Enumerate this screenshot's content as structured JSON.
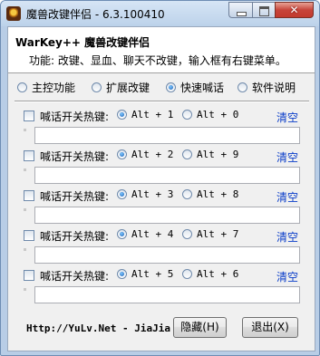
{
  "window": {
    "title": "魔兽改键伴侣 - 6.3.100410"
  },
  "header": {
    "title": "WarKey++ 魔兽改键伴侣",
    "subtitle": "功能: 改键、显血、聊天不改键，输入框有右键菜单。"
  },
  "tabs": [
    {
      "label": "主控功能",
      "selected": false
    },
    {
      "label": "扩展改键",
      "selected": false
    },
    {
      "label": "快速喊话",
      "selected": true
    },
    {
      "label": "软件说明",
      "selected": false
    }
  ],
  "rows": [
    {
      "label": "喊话开关热键:",
      "opt1": "Alt + 1",
      "opt2": "Alt + 0",
      "selected": 1,
      "clear": "清空",
      "value": ""
    },
    {
      "label": "喊话开关热键:",
      "opt1": "Alt + 2",
      "opt2": "Alt + 9",
      "selected": 1,
      "clear": "清空",
      "value": ""
    },
    {
      "label": "喊话开关热键:",
      "opt1": "Alt + 3",
      "opt2": "Alt + 8",
      "selected": 1,
      "clear": "清空",
      "value": ""
    },
    {
      "label": "喊话开关热键:",
      "opt1": "Alt + 4",
      "opt2": "Alt + 7",
      "selected": 1,
      "clear": "清空",
      "value": ""
    },
    {
      "label": "喊话开关热键:",
      "opt1": "Alt + 5",
      "opt2": "Alt + 6",
      "selected": 1,
      "clear": "清空",
      "value": ""
    }
  ],
  "footer": {
    "link": "Http://YuLv.Net - JiaJia",
    "hide_label": "隐藏(H)",
    "exit_label": "退出(X)"
  }
}
